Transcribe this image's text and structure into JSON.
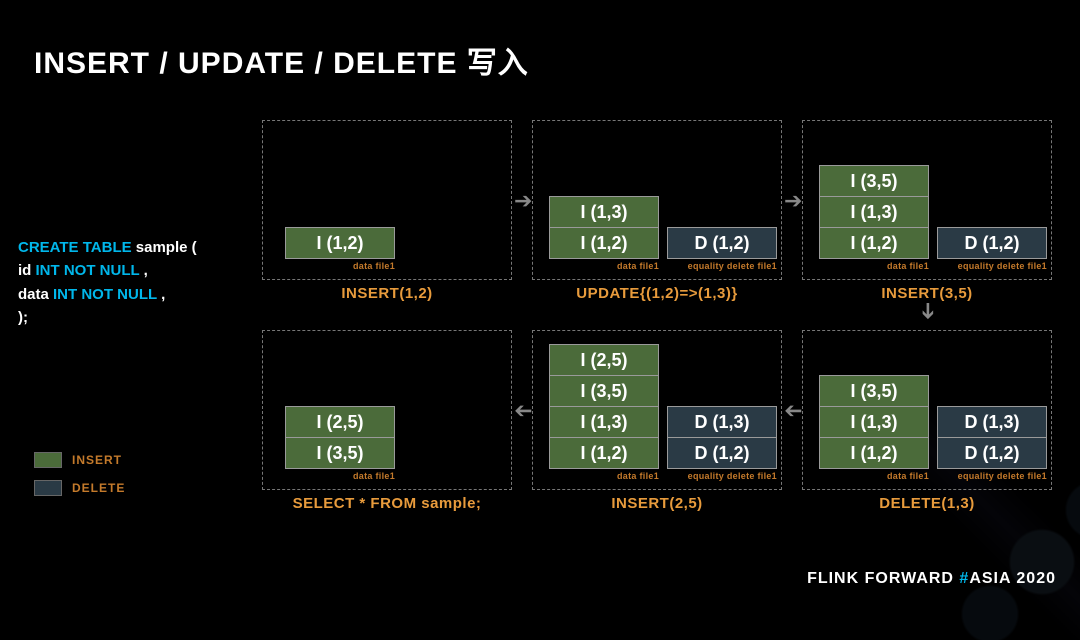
{
  "title": "INSERT / UPDATE / DELETE 写入",
  "sql": {
    "l1a": "CREATE TABLE",
    "l1b": " sample (",
    "l2a": " id  ",
    "l2b": "INT NOT NULL",
    "l2c": ",",
    "l3a": " data ",
    "l3b": "INT NOT NULL",
    "l3c": ",",
    "l4": ");"
  },
  "legend": {
    "insert": "INSERT",
    "delete": "DELETE"
  },
  "labels": {
    "datafile": "data file1",
    "eqdel": "equality delete file1"
  },
  "panels": {
    "p1": {
      "caption": "INSERT(1,2)",
      "data": [
        "I (1,2)"
      ],
      "del": []
    },
    "p2": {
      "caption": "UPDATE{(1,2)=>(1,3)}",
      "data": [
        "I (1,3)",
        "I (1,2)"
      ],
      "del": [
        "D (1,2)"
      ]
    },
    "p3": {
      "caption": "INSERT(3,5)",
      "data": [
        "I (3,5)",
        "I (1,3)",
        "I (1,2)"
      ],
      "del": [
        "D (1,2)"
      ]
    },
    "p4": {
      "caption": "DELETE(1,3)",
      "data": [
        "I (3,5)",
        "I (1,3)",
        "I (1,2)"
      ],
      "del": [
        "D (1,3)",
        "D (1,2)"
      ]
    },
    "p5": {
      "caption": "INSERT(2,5)",
      "data": [
        "I (2,5)",
        "I (3,5)",
        "I (1,3)",
        "I (1,2)"
      ],
      "del": [
        "D (1,3)",
        "D (1,2)"
      ]
    },
    "p6": {
      "caption": "SELECT * FROM sample;",
      "data": [
        "I (2,5)",
        "I (3,5)"
      ],
      "del": []
    }
  },
  "brand": {
    "a": "FLINK FORWARD ",
    "b": "#",
    "c": "ASIA 2020"
  }
}
